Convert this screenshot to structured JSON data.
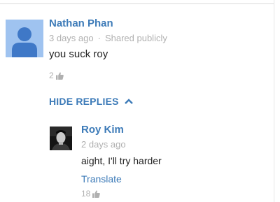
{
  "comment": {
    "author": "Nathan Phan",
    "time": "3 days ago",
    "separator": "·",
    "visibility": "Shared publicly",
    "text": "you suck roy",
    "likes": "2",
    "avatar_icon": "default-person-icon",
    "like_icon": "thumbs-up-icon"
  },
  "replies_toggle": {
    "label": "HIDE REPLIES",
    "icon": "chevron-up-icon"
  },
  "reply": {
    "author": "Roy Kim",
    "time": "2 days ago",
    "text": "aight, I'll try harder",
    "translate_label": "Translate",
    "likes": "18",
    "avatar_icon": "profile-photo",
    "like_icon": "thumbs-up-icon"
  },
  "colors": {
    "link_blue": "#3d7bb8",
    "meta_gray": "#b0b0b0",
    "avatar_bg": "#9fc3f0",
    "avatar_figure": "#3f78c7"
  }
}
